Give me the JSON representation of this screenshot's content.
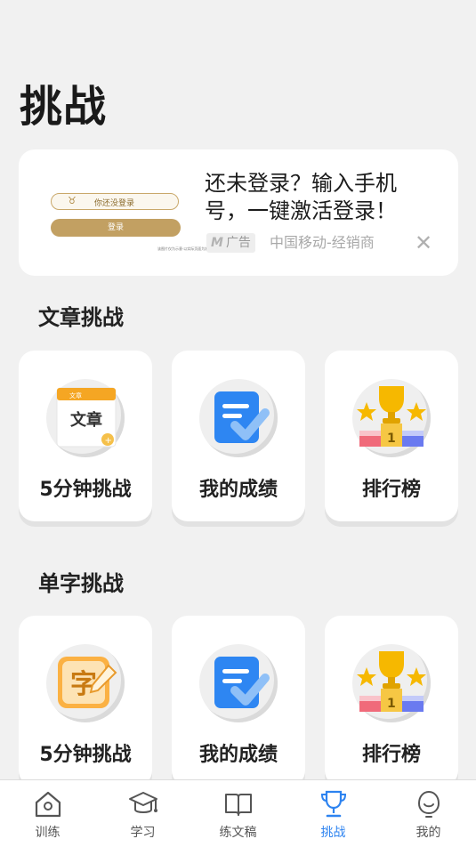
{
  "page": {
    "title": "挑战"
  },
  "ad": {
    "thumb_pill_text": "你还没登录",
    "thumb_button_text": "登录",
    "thumb_tiny_text": "该图片仅为示意·以实际页面为准",
    "headline": "还未登录？输入手机号，一键激活登录！",
    "tag_label": "广告",
    "source": "中国移动-经销商",
    "close_glyph": "✕"
  },
  "sections": [
    {
      "title": "文章挑战",
      "cards": [
        {
          "label": "5分钟挑战",
          "icon": "article-calendar-icon"
        },
        {
          "label": "我的成绩",
          "icon": "score-doc-icon"
        },
        {
          "label": "排行榜",
          "icon": "trophy-podium-icon"
        }
      ]
    },
    {
      "title": "单字挑战",
      "cards": [
        {
          "label": "5分钟挑战",
          "icon": "character-icon"
        },
        {
          "label": "我的成绩",
          "icon": "score-doc-icon"
        },
        {
          "label": "排行榜",
          "icon": "trophy-podium-icon"
        }
      ]
    }
  ],
  "icon_text": {
    "article": "文章",
    "article_small": "文章",
    "character": "字"
  },
  "bottom_nav": [
    {
      "label": "训练",
      "icon": "home-icon"
    },
    {
      "label": "学习",
      "icon": "graduation-cap-icon"
    },
    {
      "label": "练文稿",
      "icon": "book-icon"
    },
    {
      "label": "挑战",
      "icon": "trophy-icon",
      "active": true
    },
    {
      "label": "我的",
      "icon": "profile-icon"
    }
  ],
  "colors": {
    "accent": "#2d83f0",
    "background": "#f1f1f1",
    "card": "#ffffff"
  }
}
